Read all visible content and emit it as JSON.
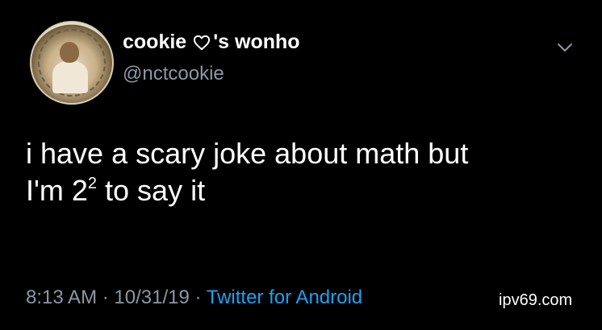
{
  "tweet": {
    "display_name_prefix": "cookie",
    "display_name_suffix": "'s wonho",
    "handle": "@nctcookie",
    "text_line_1": "i have a scary joke about math but",
    "text_line_2_before": "I'm 2",
    "text_line_2_sup": "2",
    "text_line_2_after": " to say it",
    "time": "8:13 AM",
    "date": "10/31/19",
    "separator": "·",
    "source": "Twitter for Android"
  },
  "watermark": "ipv69.com",
  "icons": {
    "heart": "heart-outline-icon",
    "chevron": "chevron-down-icon"
  },
  "colors": {
    "background": "#000000",
    "text": "#ffffff",
    "secondary_text": "#8b98a5",
    "link": "#1da1f2"
  }
}
